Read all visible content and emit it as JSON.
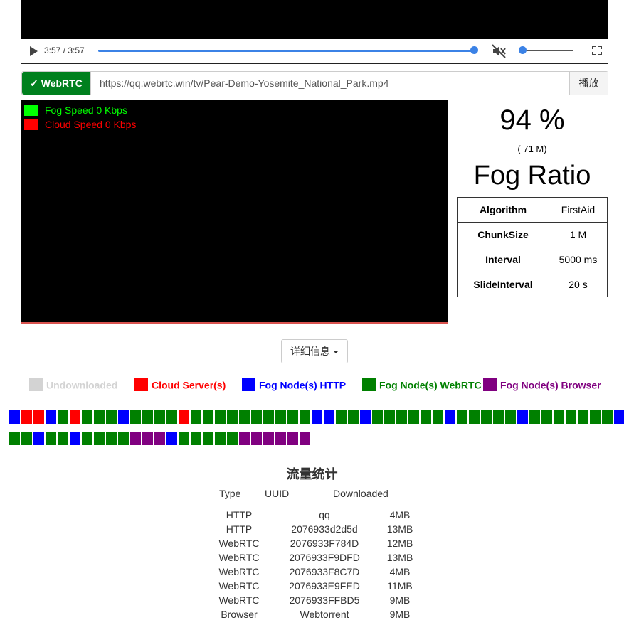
{
  "player": {
    "time": "3:57 / 3:57",
    "progress": 1.0,
    "muted": true,
    "volume": 0.0
  },
  "urlbar": {
    "mode_label": "✓ WebRTC",
    "url": "https://qq.webrtc.win/tv/Pear-Demo-Yosemite_National_Park.mp4",
    "play_label": "播放"
  },
  "speed_legend": {
    "fog": {
      "label": "Fog Speed 0 Kbps",
      "color": "#00ff00"
    },
    "cloud": {
      "label": "Cloud Speed 0 Kbps",
      "color": "#ff0000"
    }
  },
  "ratio": {
    "percent": "94 %",
    "size": "( 71 M)",
    "title": "Fog Ratio"
  },
  "stats": [
    {
      "key": "Algorithm",
      "value": "FirstAid"
    },
    {
      "key": "ChunkSize",
      "value": "1 M"
    },
    {
      "key": "Interval",
      "value": "5000 ms"
    },
    {
      "key": "SlideInterval",
      "value": "20 s"
    }
  ],
  "detail_button": "详细信息",
  "legend": [
    {
      "label": "Undownloaded",
      "color": "#d3d3d3"
    },
    {
      "label": "Cloud Server(s)",
      "color": "#ff0000"
    },
    {
      "label": "Fog Node(s) HTTP",
      "color": "#0000ff"
    },
    {
      "label": "Fog Node(s) WebRTC",
      "color": "#008000"
    },
    {
      "label": "Fog Node(s) Browser",
      "color": "#800080"
    }
  ],
  "chunk_colors": {
    "R": "#ff0000",
    "B": "#0000ff",
    "G": "#008000",
    "P": "#800080"
  },
  "chunks": [
    "BRRBGRGGGBGGGGRGGGGGGGGGGBBGGBGGGGGGBGGGGGBGGGGGGGBB",
    "GGBGGBGGGGPPPBGGGGGPPPPPP"
  ],
  "traffic": {
    "title": "流量统计",
    "headers": [
      "Type",
      "UUID",
      "Downloaded"
    ],
    "rows": [
      [
        "HTTP",
        "qq",
        "4MB"
      ],
      [
        "HTTP",
        "2076933d2d5d",
        "13MB"
      ],
      [
        "WebRTC",
        "2076933F784D",
        "12MB"
      ],
      [
        "WebRTC",
        "2076933F9DFD",
        "13MB"
      ],
      [
        "WebRTC",
        "2076933F8C7D",
        "4MB"
      ],
      [
        "WebRTC",
        "2076933E9FED",
        "11MB"
      ],
      [
        "WebRTC",
        "2076933FFBD5",
        "9MB"
      ],
      [
        "Browser",
        "Webtorrent",
        "9MB"
      ]
    ]
  }
}
